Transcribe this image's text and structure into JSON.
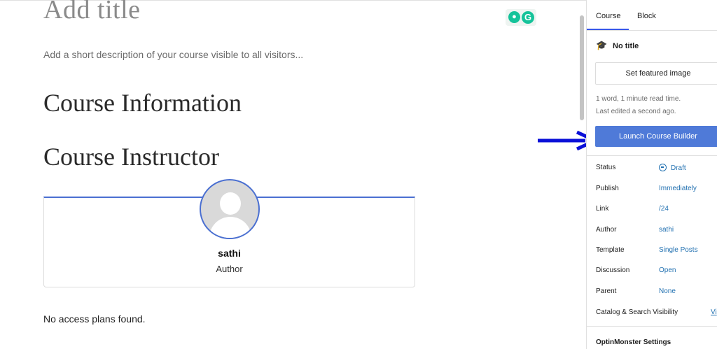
{
  "editor": {
    "title_placeholder": "Add title",
    "description_placeholder": "Add a short description of your course visible to all visitors...",
    "heading_info": "Course Information",
    "heading_instructor": "Course Instructor",
    "instructor": {
      "name": "sathi",
      "role": "Author"
    },
    "no_access_plans": "No access plans found.",
    "grammarly": {
      "bulb_icon": "lightbulb-icon",
      "logo_icon": "grammarly-g-icon",
      "logo_letter": "G"
    }
  },
  "sidebar": {
    "tabs": [
      {
        "label": "Course",
        "active": true
      },
      {
        "label": "Block",
        "active": false
      }
    ],
    "post_title": "No title",
    "post_icon": "graduation-cap-icon",
    "featured_image_button": "Set featured image",
    "word_count": "1 word, 1 minute read time.",
    "last_edited": "Last edited a second ago.",
    "launch_button": "Launch Course Builder",
    "rows": [
      {
        "label": "Status",
        "value": "Draft"
      },
      {
        "label": "Publish",
        "value": "Immediately"
      },
      {
        "label": "Link",
        "value": "/24"
      },
      {
        "label": "Author",
        "value": "sathi"
      },
      {
        "label": "Template",
        "value": "Single Posts"
      },
      {
        "label": "Discussion",
        "value": "Open"
      },
      {
        "label": "Parent",
        "value": "None"
      }
    ],
    "catalog_visibility": {
      "label": "Catalog & Search Visibility",
      "value": "Vi"
    },
    "optinmonster": "OptinMonster Settings"
  },
  "colors": {
    "accent": "#3858e9",
    "launch_button": "#4f7ad8",
    "link": "#2271b1",
    "annotation_arrow": "#0a10d8",
    "card_border": "#4a6fd1"
  }
}
